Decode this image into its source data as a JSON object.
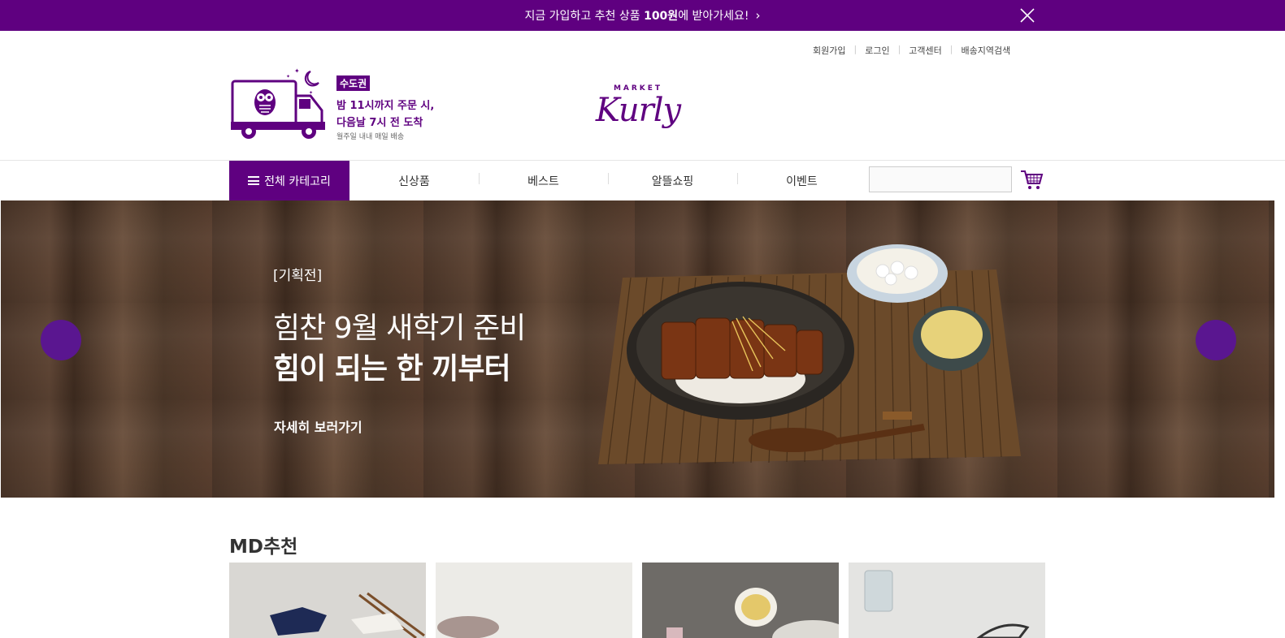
{
  "promo_bar": {
    "text_before": "지금 가입하고 추천 상품 ",
    "text_bold": "100원",
    "text_after": "에 받아가세요!",
    "chevron": "›"
  },
  "user_links": {
    "signup": "회원가입",
    "login": "로그인",
    "customer_center": "고객센터",
    "delivery_check": "배송지역검색"
  },
  "delivery": {
    "badge": "수도권",
    "line1": "밤 11시까지 주문 시,",
    "line2": "다음날 7시 전 도착",
    "line3": "월주일 내내 매일 배송"
  },
  "logo": {
    "small": "MARKET",
    "big": "Kurly"
  },
  "gnb": {
    "all_category": "전체 카테고리",
    "menu": [
      "신상품",
      "베스트",
      "알뜰쇼핑",
      "이벤트"
    ]
  },
  "banner": {
    "tag": "[기획전]",
    "title1": "힘찬 9월 새학기 준비",
    "title2": "힘이 되는 한 끼부터",
    "more": "자세히 보러가기"
  },
  "md": {
    "title": "MD추천"
  },
  "colors": {
    "brand": "#5f0080",
    "arrow": "#5a1690"
  },
  "icons": {
    "close": "close-icon",
    "cart": "cart-icon",
    "menu": "hamburger-icon",
    "truck": "truck-owl-icon"
  }
}
